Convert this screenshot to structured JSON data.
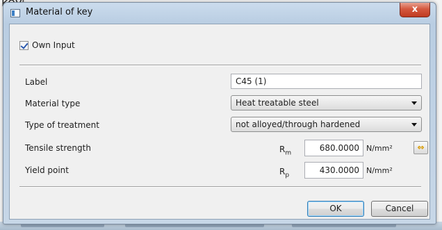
{
  "background": {
    "partial_text": "key:"
  },
  "window": {
    "title": "Material of key",
    "close_glyph": "x"
  },
  "own_input": {
    "label": "Own Input",
    "checked": true
  },
  "fields": {
    "label": {
      "label": "Label",
      "value": "C45 (1)"
    },
    "material_type": {
      "label": "Material type",
      "selected": "Heat treatable steel"
    },
    "treatment": {
      "label": "Type of treatment",
      "selected": "not alloyed/through hardened"
    },
    "tensile": {
      "label": "Tensile strength",
      "symbol": "R",
      "symbol_sub": "m",
      "value": "680.0000",
      "unit": "N/mm²"
    },
    "yield": {
      "label": "Yield point",
      "symbol": "R",
      "symbol_sub": "p",
      "value": "430.0000",
      "unit": "N/mm²"
    }
  },
  "buttons": {
    "ok": "OK",
    "cancel": "Cancel"
  },
  "icons": {
    "window": "window-icon",
    "close": "close-icon",
    "dropdown": "chevron-down-icon",
    "transfer": "double-arrow-icon",
    "checkbox": "checkmark-icon"
  },
  "colors": {
    "title_bar": "#b9cde2",
    "close_button": "#c94a32",
    "dialog_body": "#f0f0f0",
    "default_button_border": "#3c7fb1"
  }
}
